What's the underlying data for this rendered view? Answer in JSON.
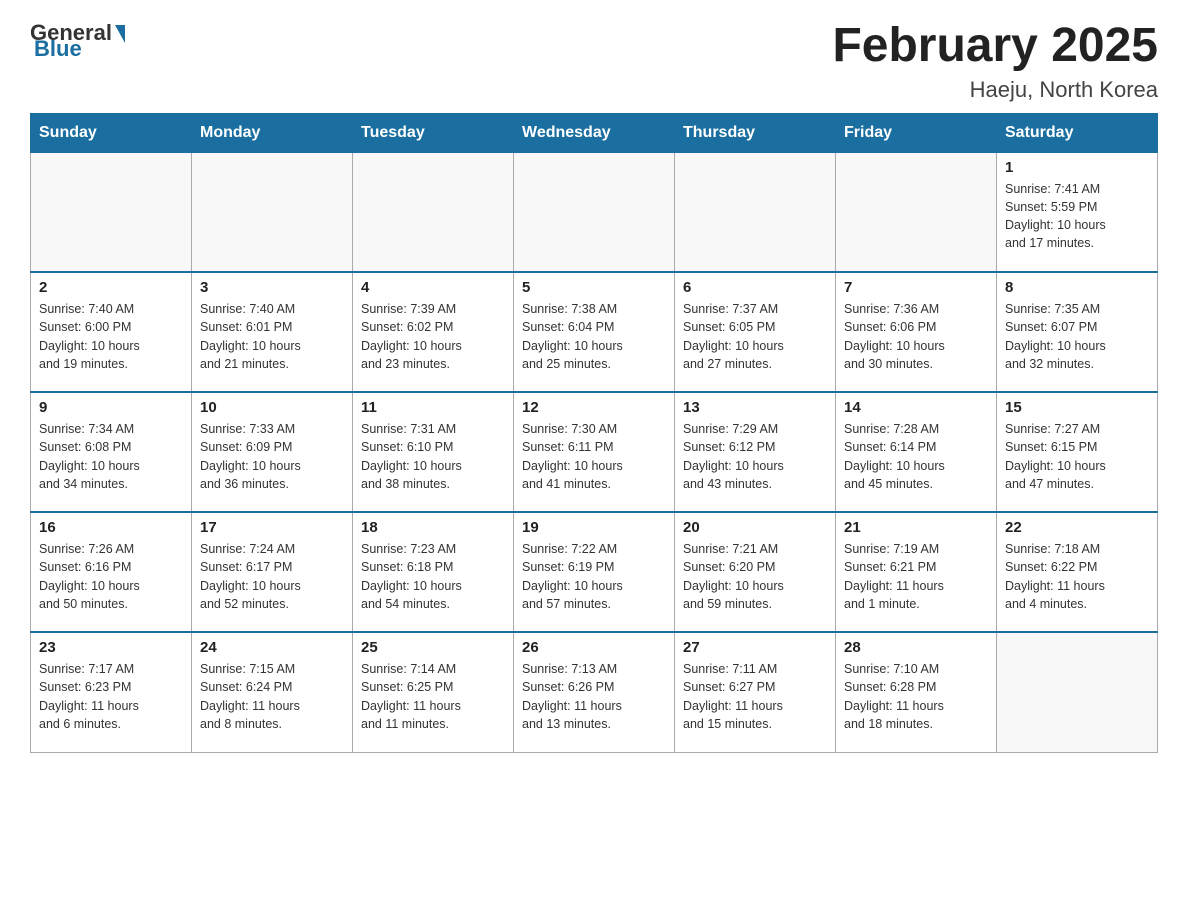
{
  "logo": {
    "general": "General",
    "blue": "Blue"
  },
  "title": "February 2025",
  "subtitle": "Haeju, North Korea",
  "weekdays": [
    "Sunday",
    "Monday",
    "Tuesday",
    "Wednesday",
    "Thursday",
    "Friday",
    "Saturday"
  ],
  "weeks": [
    [
      {
        "day": "",
        "info": ""
      },
      {
        "day": "",
        "info": ""
      },
      {
        "day": "",
        "info": ""
      },
      {
        "day": "",
        "info": ""
      },
      {
        "day": "",
        "info": ""
      },
      {
        "day": "",
        "info": ""
      },
      {
        "day": "1",
        "info": "Sunrise: 7:41 AM\nSunset: 5:59 PM\nDaylight: 10 hours\nand 17 minutes."
      }
    ],
    [
      {
        "day": "2",
        "info": "Sunrise: 7:40 AM\nSunset: 6:00 PM\nDaylight: 10 hours\nand 19 minutes."
      },
      {
        "day": "3",
        "info": "Sunrise: 7:40 AM\nSunset: 6:01 PM\nDaylight: 10 hours\nand 21 minutes."
      },
      {
        "day": "4",
        "info": "Sunrise: 7:39 AM\nSunset: 6:02 PM\nDaylight: 10 hours\nand 23 minutes."
      },
      {
        "day": "5",
        "info": "Sunrise: 7:38 AM\nSunset: 6:04 PM\nDaylight: 10 hours\nand 25 minutes."
      },
      {
        "day": "6",
        "info": "Sunrise: 7:37 AM\nSunset: 6:05 PM\nDaylight: 10 hours\nand 27 minutes."
      },
      {
        "day": "7",
        "info": "Sunrise: 7:36 AM\nSunset: 6:06 PM\nDaylight: 10 hours\nand 30 minutes."
      },
      {
        "day": "8",
        "info": "Sunrise: 7:35 AM\nSunset: 6:07 PM\nDaylight: 10 hours\nand 32 minutes."
      }
    ],
    [
      {
        "day": "9",
        "info": "Sunrise: 7:34 AM\nSunset: 6:08 PM\nDaylight: 10 hours\nand 34 minutes."
      },
      {
        "day": "10",
        "info": "Sunrise: 7:33 AM\nSunset: 6:09 PM\nDaylight: 10 hours\nand 36 minutes."
      },
      {
        "day": "11",
        "info": "Sunrise: 7:31 AM\nSunset: 6:10 PM\nDaylight: 10 hours\nand 38 minutes."
      },
      {
        "day": "12",
        "info": "Sunrise: 7:30 AM\nSunset: 6:11 PM\nDaylight: 10 hours\nand 41 minutes."
      },
      {
        "day": "13",
        "info": "Sunrise: 7:29 AM\nSunset: 6:12 PM\nDaylight: 10 hours\nand 43 minutes."
      },
      {
        "day": "14",
        "info": "Sunrise: 7:28 AM\nSunset: 6:14 PM\nDaylight: 10 hours\nand 45 minutes."
      },
      {
        "day": "15",
        "info": "Sunrise: 7:27 AM\nSunset: 6:15 PM\nDaylight: 10 hours\nand 47 minutes."
      }
    ],
    [
      {
        "day": "16",
        "info": "Sunrise: 7:26 AM\nSunset: 6:16 PM\nDaylight: 10 hours\nand 50 minutes."
      },
      {
        "day": "17",
        "info": "Sunrise: 7:24 AM\nSunset: 6:17 PM\nDaylight: 10 hours\nand 52 minutes."
      },
      {
        "day": "18",
        "info": "Sunrise: 7:23 AM\nSunset: 6:18 PM\nDaylight: 10 hours\nand 54 minutes."
      },
      {
        "day": "19",
        "info": "Sunrise: 7:22 AM\nSunset: 6:19 PM\nDaylight: 10 hours\nand 57 minutes."
      },
      {
        "day": "20",
        "info": "Sunrise: 7:21 AM\nSunset: 6:20 PM\nDaylight: 10 hours\nand 59 minutes."
      },
      {
        "day": "21",
        "info": "Sunrise: 7:19 AM\nSunset: 6:21 PM\nDaylight: 11 hours\nand 1 minute."
      },
      {
        "day": "22",
        "info": "Sunrise: 7:18 AM\nSunset: 6:22 PM\nDaylight: 11 hours\nand 4 minutes."
      }
    ],
    [
      {
        "day": "23",
        "info": "Sunrise: 7:17 AM\nSunset: 6:23 PM\nDaylight: 11 hours\nand 6 minutes."
      },
      {
        "day": "24",
        "info": "Sunrise: 7:15 AM\nSunset: 6:24 PM\nDaylight: 11 hours\nand 8 minutes."
      },
      {
        "day": "25",
        "info": "Sunrise: 7:14 AM\nSunset: 6:25 PM\nDaylight: 11 hours\nand 11 minutes."
      },
      {
        "day": "26",
        "info": "Sunrise: 7:13 AM\nSunset: 6:26 PM\nDaylight: 11 hours\nand 13 minutes."
      },
      {
        "day": "27",
        "info": "Sunrise: 7:11 AM\nSunset: 6:27 PM\nDaylight: 11 hours\nand 15 minutes."
      },
      {
        "day": "28",
        "info": "Sunrise: 7:10 AM\nSunset: 6:28 PM\nDaylight: 11 hours\nand 18 minutes."
      },
      {
        "day": "",
        "info": ""
      }
    ]
  ]
}
